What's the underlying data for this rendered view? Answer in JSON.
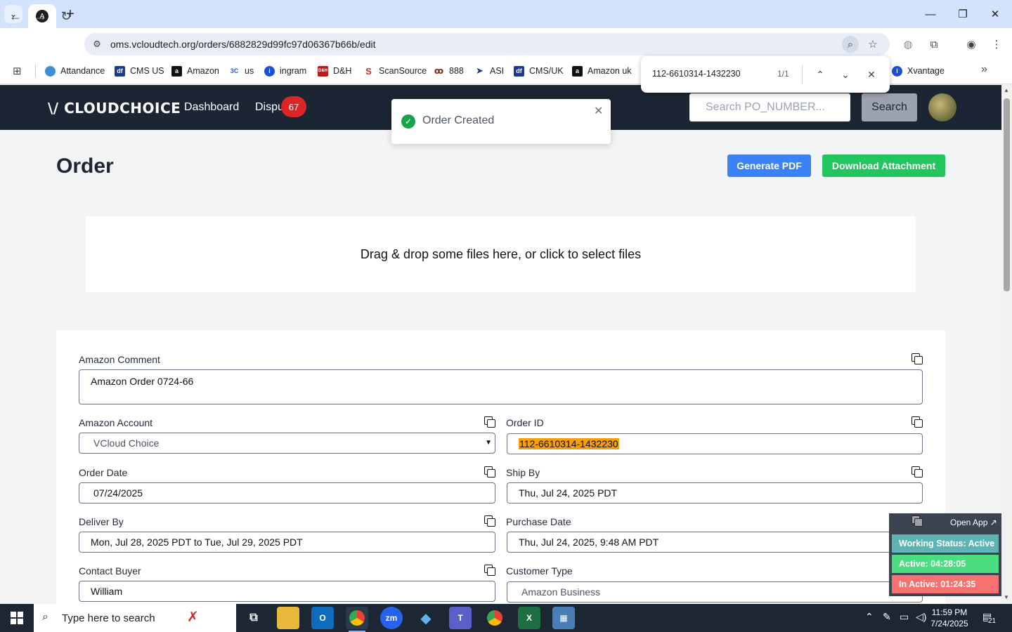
{
  "browser": {
    "url": "oms.vcloudtech.org/orders/6882829d99fc97d06367b66b/edit",
    "tab_favicon": "A",
    "bookmarks": [
      {
        "label": "Attandance",
        "color": "#3f8fd2",
        "icon": "diamond"
      },
      {
        "label": "CMS US",
        "color": "#1e3a8a",
        "icon": "df"
      },
      {
        "label": "Amazon",
        "color": "#111111",
        "icon": "a"
      },
      {
        "label": "us",
        "color": "#2563eb",
        "icon": "3c"
      },
      {
        "label": "ingram",
        "color": "#1d4ed8",
        "icon": "i"
      },
      {
        "label": "D&H",
        "color": "#b91c1c",
        "icon": "D&H"
      },
      {
        "label": "ScanSource",
        "color": "#dc2626",
        "icon": "S"
      },
      {
        "label": "888",
        "color": "#7c2d12",
        "icon": "8"
      },
      {
        "label": "ASI",
        "color": "#1e3a8a",
        "icon": ">"
      },
      {
        "label": "CMS/UK",
        "color": "#1e3a8a",
        "icon": "df"
      },
      {
        "label": "Amazon uk",
        "color": "#111111",
        "icon": "a"
      },
      {
        "label": "Xvantage",
        "color": "#1d4ed8",
        "icon": "i"
      }
    ],
    "find": {
      "query": "112-6610314-1432230",
      "count": "1/1"
    }
  },
  "nav": {
    "logo": "\\/ CLOUDCHOICE",
    "dashboard": "Dashboard",
    "disputes": "Dispu",
    "badge": "67",
    "search_placeholder": "Search PO_NUMBER...",
    "search_button": "Search"
  },
  "toast": {
    "message": "Order Created"
  },
  "page": {
    "title": "Order",
    "generate_pdf": "Generate PDF",
    "download_attachment": "Download Attachment",
    "dropzone": "Drag & drop some files here, or click to select files"
  },
  "form": {
    "amazon_comment_label": "Amazon Comment",
    "amazon_comment_value": "Amazon Order 0724-66",
    "amazon_account_label": "Amazon Account",
    "amazon_account_value": "VCloud Choice",
    "order_id_label": "Order ID",
    "order_id_value": "112-6610314-1432230",
    "order_date_label": "Order Date",
    "order_date_value": "07/24/2025",
    "ship_by_label": "Ship By",
    "ship_by_value": "Thu, Jul 24, 2025 PDT",
    "deliver_by_label": "Deliver By",
    "deliver_by_value": "Mon, Jul 28, 2025 PDT to Tue, Jul 29, 2025 PDT",
    "purchase_date_label": "Purchase Date",
    "purchase_date_value": "Thu, Jul 24, 2025, 9:48 AM PDT",
    "contact_buyer_label": "Contact Buyer",
    "contact_buyer_value": "William",
    "customer_type_label": "Customer Type",
    "customer_type_value": "Amazon Business"
  },
  "work_widget": {
    "open_app": "Open App ↗",
    "status": "Working Status: Active",
    "active": "Active: 04:28:05",
    "inactive": "In Active: 01:24:35",
    "colors": {
      "status": "#5fb3b3",
      "active": "#4ade80",
      "inactive": "#f87171"
    }
  },
  "taskbar": {
    "search_placeholder": "Type here to search",
    "time": "11:59 PM",
    "date": "7/24/2025",
    "notifications": "21"
  }
}
